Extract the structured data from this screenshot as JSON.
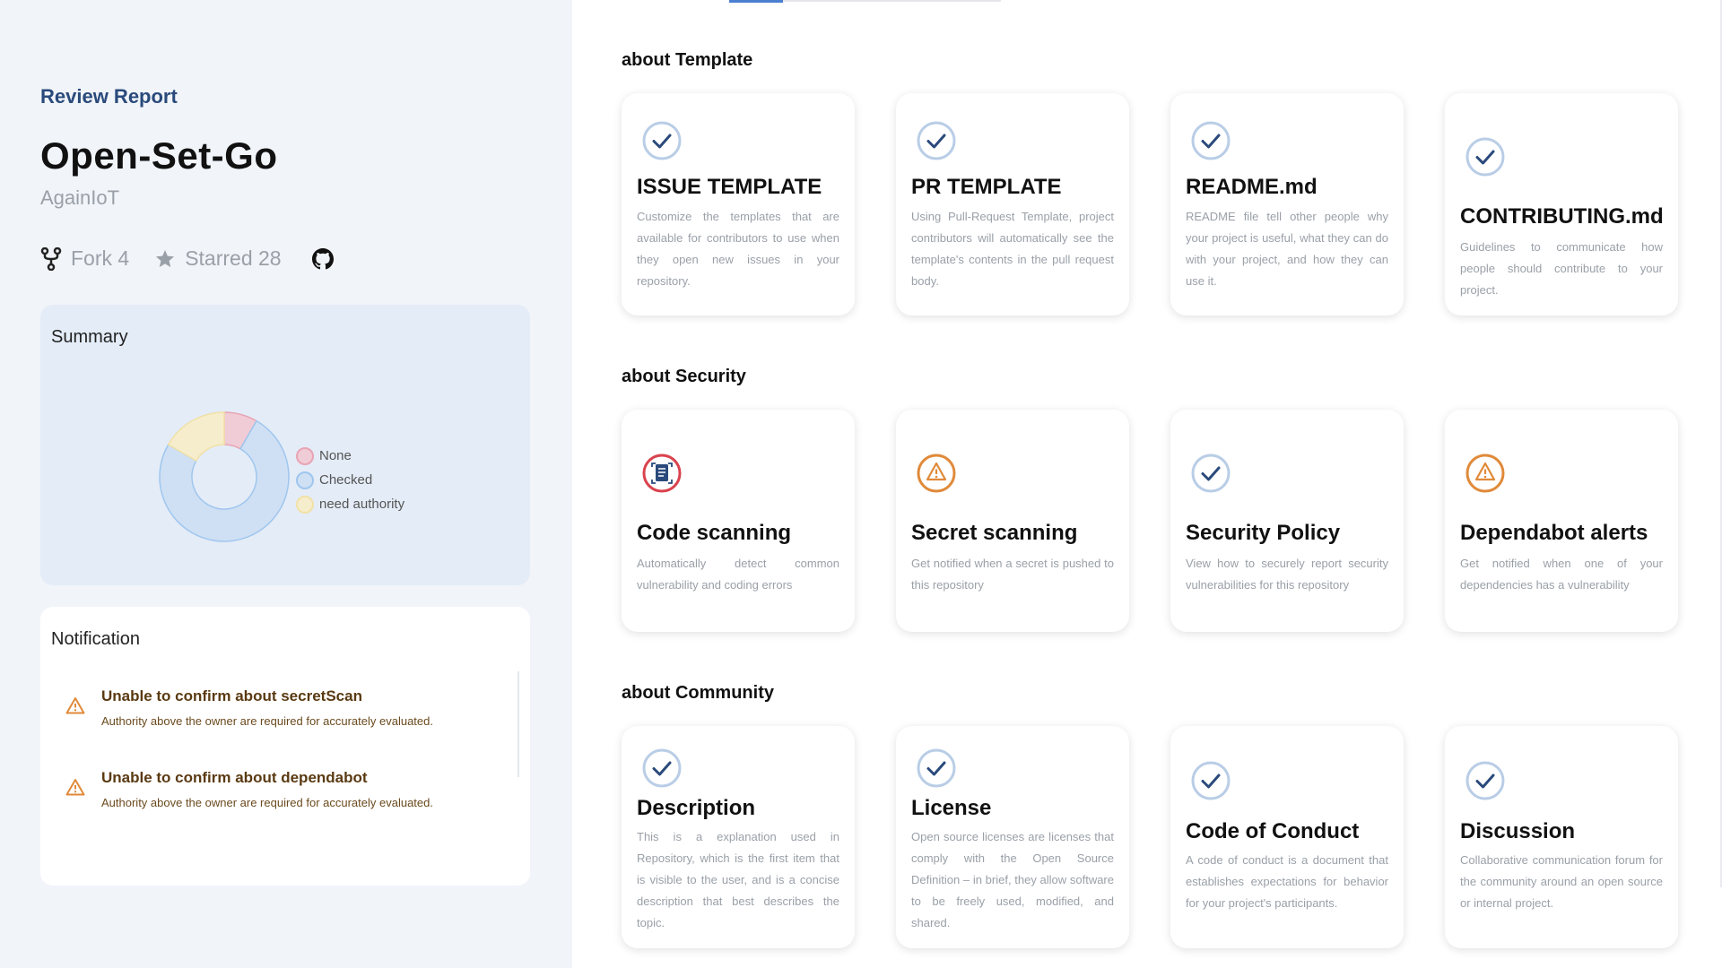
{
  "sidebar": {
    "review_label": "Review Report",
    "repo_name": "Open-Set-Go",
    "owner": "AgainIoT",
    "fork_label": "Fork 4",
    "star_label": "Starred 28"
  },
  "summary": {
    "title": "Summary",
    "legend": [
      {
        "label": "None",
        "color": "#e8a4b4"
      },
      {
        "label": "Checked",
        "color": "#9fc6ee"
      },
      {
        "label": "need authority",
        "color": "#f1e1a6"
      }
    ]
  },
  "chart_data": {
    "type": "pie",
    "categories": [
      "None",
      "Checked",
      "need authority"
    ],
    "values": [
      1,
      9,
      2
    ],
    "colors": [
      "#e8a4b4",
      "#9fc6ee",
      "#f1e1a6"
    ],
    "legend_position": "right"
  },
  "notification": {
    "title": "Notification",
    "items": [
      {
        "title": "Unable to confirm about secretScan",
        "body": "Authority above the owner are required for accurately evaluated."
      },
      {
        "title": "Unable to confirm about dependabot",
        "body": "Authority above the owner are required for accurately evaluated."
      }
    ]
  },
  "sections": [
    {
      "title": "about Template",
      "cards": [
        {
          "status": "check",
          "title": "ISSUE TEMPLATE",
          "desc": "Customize the templates that are available for contributors to use when they open new issues in your repository."
        },
        {
          "status": "check",
          "title": "PR TEMPLATE",
          "desc": "Using Pull-Request Template, project contributors will automatically see the template's contents in the pull request body."
        },
        {
          "status": "check",
          "title": "README.md",
          "desc": "README file tell other people why your project is useful, what they can do with your project, and how they can use it."
        },
        {
          "status": "check",
          "title": "CONTRIBUTING.md",
          "desc": "Guidelines to communicate how people should contribute to your project."
        }
      ]
    },
    {
      "title": "about Security",
      "cards": [
        {
          "status": "none",
          "title": "Code scanning",
          "desc": "Automatically detect common vulnerability and coding errors"
        },
        {
          "status": "warning",
          "title": "Secret scanning",
          "desc": "Get notified when a secret is pushed to this repository"
        },
        {
          "status": "check",
          "title": "Security Policy",
          "desc": "View how to securely report security vulnerabilities for this repository"
        },
        {
          "status": "warning",
          "title": "Dependabot alerts",
          "desc": "Get notified when one of your dependencies has a vulnerability"
        }
      ]
    },
    {
      "title": "about Community",
      "cards": [
        {
          "status": "check",
          "title": "Description",
          "desc": "This is a explanation used in Repository, which is the first item that is visible to the user, and is a concise description that best describes the topic."
        },
        {
          "status": "check",
          "title": "License",
          "desc": "Open source licenses are licenses that comply with the Open Source Definition – in brief, they allow software to be freely used, modified, and shared."
        },
        {
          "status": "check",
          "title": "Code of Conduct",
          "desc": "A code of conduct is a document that establishes expectations for behavior for your project's participants."
        },
        {
          "status": "check",
          "title": "Discussion",
          "desc": "Collaborative communication forum for the community around an open source or internal project."
        }
      ]
    }
  ],
  "colors": {
    "check": "#2a4a7b",
    "warning": "#e08a3a",
    "none": "#d9434e"
  }
}
